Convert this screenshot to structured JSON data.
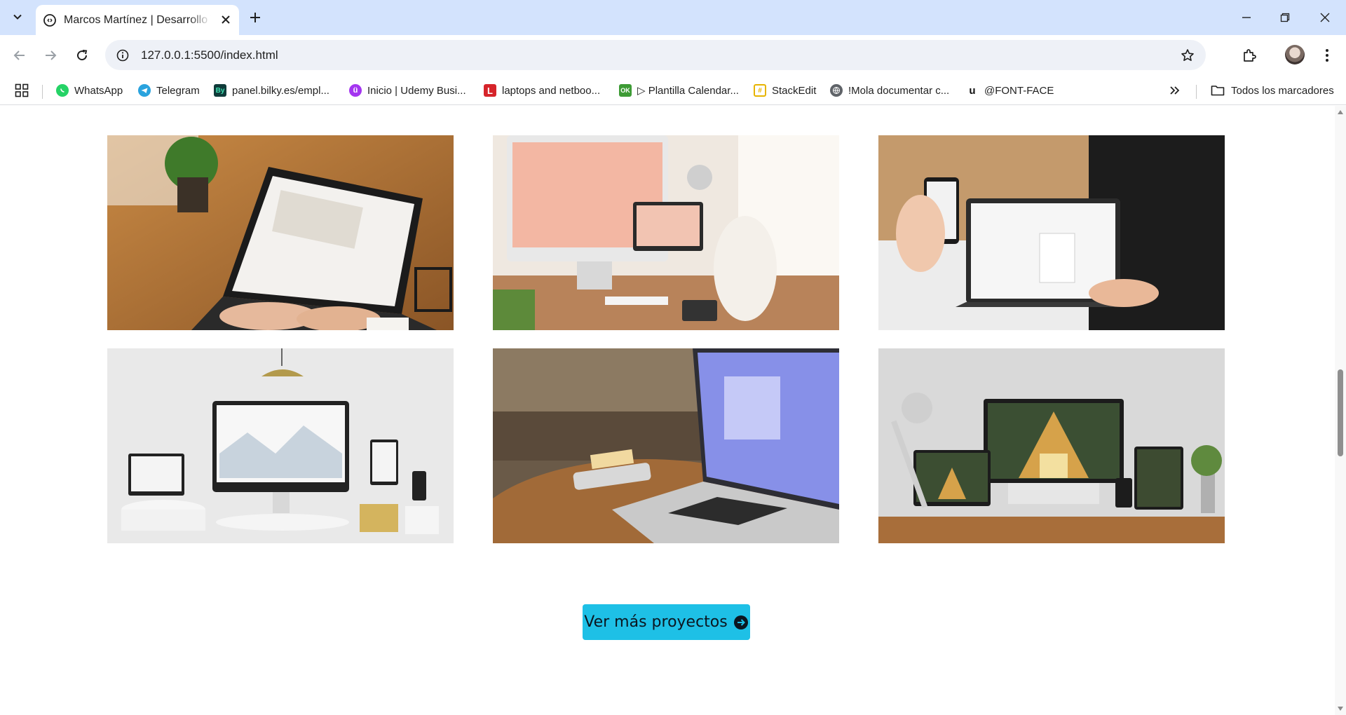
{
  "browser": {
    "tab_title": "Marcos Martínez | Desarrollo W",
    "url": "127.0.0.1:5500/index.html"
  },
  "bookmarks": [
    {
      "label": "WhatsApp",
      "icon": "whatsapp-icon",
      "color": "#25d366"
    },
    {
      "label": "Telegram",
      "icon": "telegram-icon",
      "color": "#2aa3de"
    },
    {
      "label": "panel.bilky.es/empl...",
      "icon": "bilky-icon",
      "color": "#0f3b3a"
    },
    {
      "label": "Inicio | Udemy Busi...",
      "icon": "udemy-icon",
      "color": "#a435f0"
    },
    {
      "label": "laptops and netboo...",
      "icon": "l-icon",
      "color": "#d6242a"
    },
    {
      "label": "▷ Plantilla Calendar...",
      "icon": "ok-icon",
      "color": "#3d9b35"
    },
    {
      "label": "StackEdit",
      "icon": "stackedit-icon",
      "color": "#e7b400"
    },
    {
      "label": "!Mola documentar c...",
      "icon": "globe-icon",
      "color": "#5f6368"
    },
    {
      "label": "@FONT-FACE",
      "icon": "u-icon",
      "color": "#111111"
    }
  ],
  "bookmarks_all": "Todos los marcadores",
  "projects": [
    {
      "name": "project-laptop-ux-design"
    },
    {
      "name": "project-imac-creativity"
    },
    {
      "name": "project-phone-laptop"
    },
    {
      "name": "project-responsive-web-design"
    },
    {
      "name": "project-macbook-desk"
    },
    {
      "name": "project-architect-studio"
    }
  ],
  "cta": {
    "label": "Ver más proyectos",
    "color": "#1ec0e6"
  }
}
